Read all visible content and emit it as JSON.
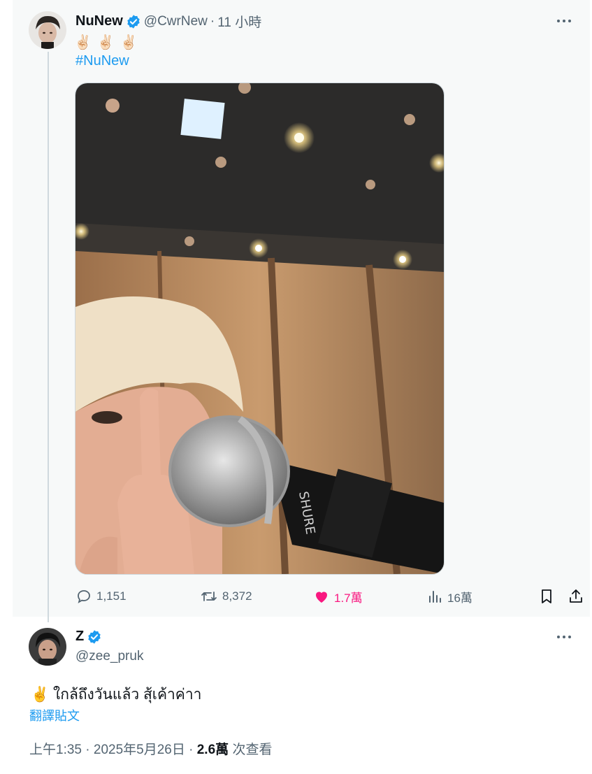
{
  "parent_tweet": {
    "author_name": "NuNew",
    "handle": "@CwrNew",
    "separator": "·",
    "time": "11 小時",
    "emojis": "✌🏻✌🏻✌🏻",
    "hashtag": "#NuNew",
    "stats": {
      "replies": "1,151",
      "retweets": "8,372",
      "likes": "1.7萬",
      "views": "16萬"
    }
  },
  "reply_tweet": {
    "author_name": "Z",
    "handle": "@zee_pruk",
    "text": "✌️ ใกล้ถึงวันแล้ว สุ้เค้าค่าา",
    "translate_label": "翻譯貼文",
    "time": "上午1:35",
    "date": "2025年5月26日",
    "dot": "·",
    "views_count": "2.6萬",
    "views_label": "次查看"
  },
  "colors": {
    "accent": "#1d9bf0",
    "like": "#f91880",
    "muted": "#536471"
  },
  "media": {
    "brand_on_mic": "SHURE"
  }
}
